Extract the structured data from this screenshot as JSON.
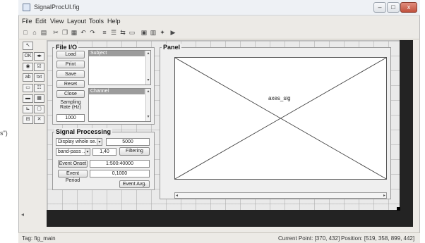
{
  "window": {
    "title": "SignalProcUI.fig",
    "minimize_glyph": "–",
    "maximize_glyph": "□",
    "close_glyph": "x"
  },
  "menu": [
    "File",
    "Edit",
    "View",
    "Layout",
    "Tools",
    "Help"
  ],
  "toolbar_icons": [
    {
      "name": "new-icon",
      "glyph": "□"
    },
    {
      "name": "open-icon",
      "glyph": "⌂"
    },
    {
      "name": "save-icon",
      "glyph": "▤"
    },
    {
      "name": "cut-icon",
      "glyph": "✂"
    },
    {
      "name": "copy-icon",
      "glyph": "❐"
    },
    {
      "name": "paste-icon",
      "glyph": "▦"
    },
    {
      "name": "undo-icon",
      "glyph": "↶"
    },
    {
      "name": "redo-icon",
      "glyph": "↷"
    },
    {
      "name": "align-icon",
      "glyph": "≡"
    },
    {
      "name": "menu-editor-icon",
      "glyph": "☰"
    },
    {
      "name": "tab-order-icon",
      "glyph": "⇆"
    },
    {
      "name": "toolbar-editor-icon",
      "glyph": "▭"
    },
    {
      "name": "mfile-editor-icon",
      "glyph": "▣"
    },
    {
      "name": "property-inspector-icon",
      "glyph": "▥"
    },
    {
      "name": "object-browser-icon",
      "glyph": "✦"
    },
    {
      "name": "run-icon",
      "glyph": "▶"
    }
  ],
  "palette": [
    {
      "name": "select-tool-icon",
      "glyph": "↖"
    },
    {
      "name": "pushbutton-tool-icon",
      "glyph": "OK"
    },
    {
      "name": "slider-tool-icon",
      "glyph": "◂▸"
    },
    {
      "name": "radiobutton-tool-icon",
      "glyph": "◉"
    },
    {
      "name": "checkbox-tool-icon",
      "glyph": "☑"
    },
    {
      "name": "edit-text-tool-icon",
      "glyph": "ab"
    },
    {
      "name": "static-text-tool-icon",
      "glyph": "txt"
    },
    {
      "name": "popup-menu-tool-icon",
      "glyph": "▭"
    },
    {
      "name": "listbox-tool-icon",
      "glyph": "☷"
    },
    {
      "name": "toggle-button-tool-icon",
      "glyph": "▬"
    },
    {
      "name": "table-tool-icon",
      "glyph": "▦"
    },
    {
      "name": "axes-tool-icon",
      "glyph": "⊾"
    },
    {
      "name": "panel-tool-icon",
      "glyph": "▢"
    },
    {
      "name": "button-group-tool-icon",
      "glyph": "⊟"
    },
    {
      "name": "activex-tool-icon",
      "glyph": "✕"
    }
  ],
  "file_io": {
    "title": "File I/O",
    "buttons": [
      "Load",
      "Print",
      "Save",
      "Reset",
      "Close"
    ],
    "subject_list": "Subject",
    "channel_list": "Channel",
    "sampling_rate_label": "Sampling Rate (Hz)",
    "sampling_rate_value": "1000"
  },
  "signal_processing": {
    "title": "Signal Processing",
    "display_combo": "Display whole se...",
    "display_value": "5000",
    "filter_combo": "band-pass ...",
    "filter_value": "1,40",
    "filtering_button": "Filtering",
    "event_onset_label": "Event Onset",
    "event_onset_value": "1:500:40000",
    "event_period_label": "Event Period",
    "event_period_value": "0,1000",
    "event_avg_button": "Event Avg."
  },
  "panel": {
    "title": "Panel",
    "axes_tag": "axes_sig"
  },
  "status": {
    "tag": "Tag: fig_main",
    "current_point": "Current Point:  [370, 432]",
    "position": "Position:  [519, 358, 899, 442]"
  },
  "outside_label": "s\")",
  "colors": {
    "layout_background": "#eaeaea",
    "dark_margin": "#232323",
    "list_selection": "#9c9c9c"
  }
}
